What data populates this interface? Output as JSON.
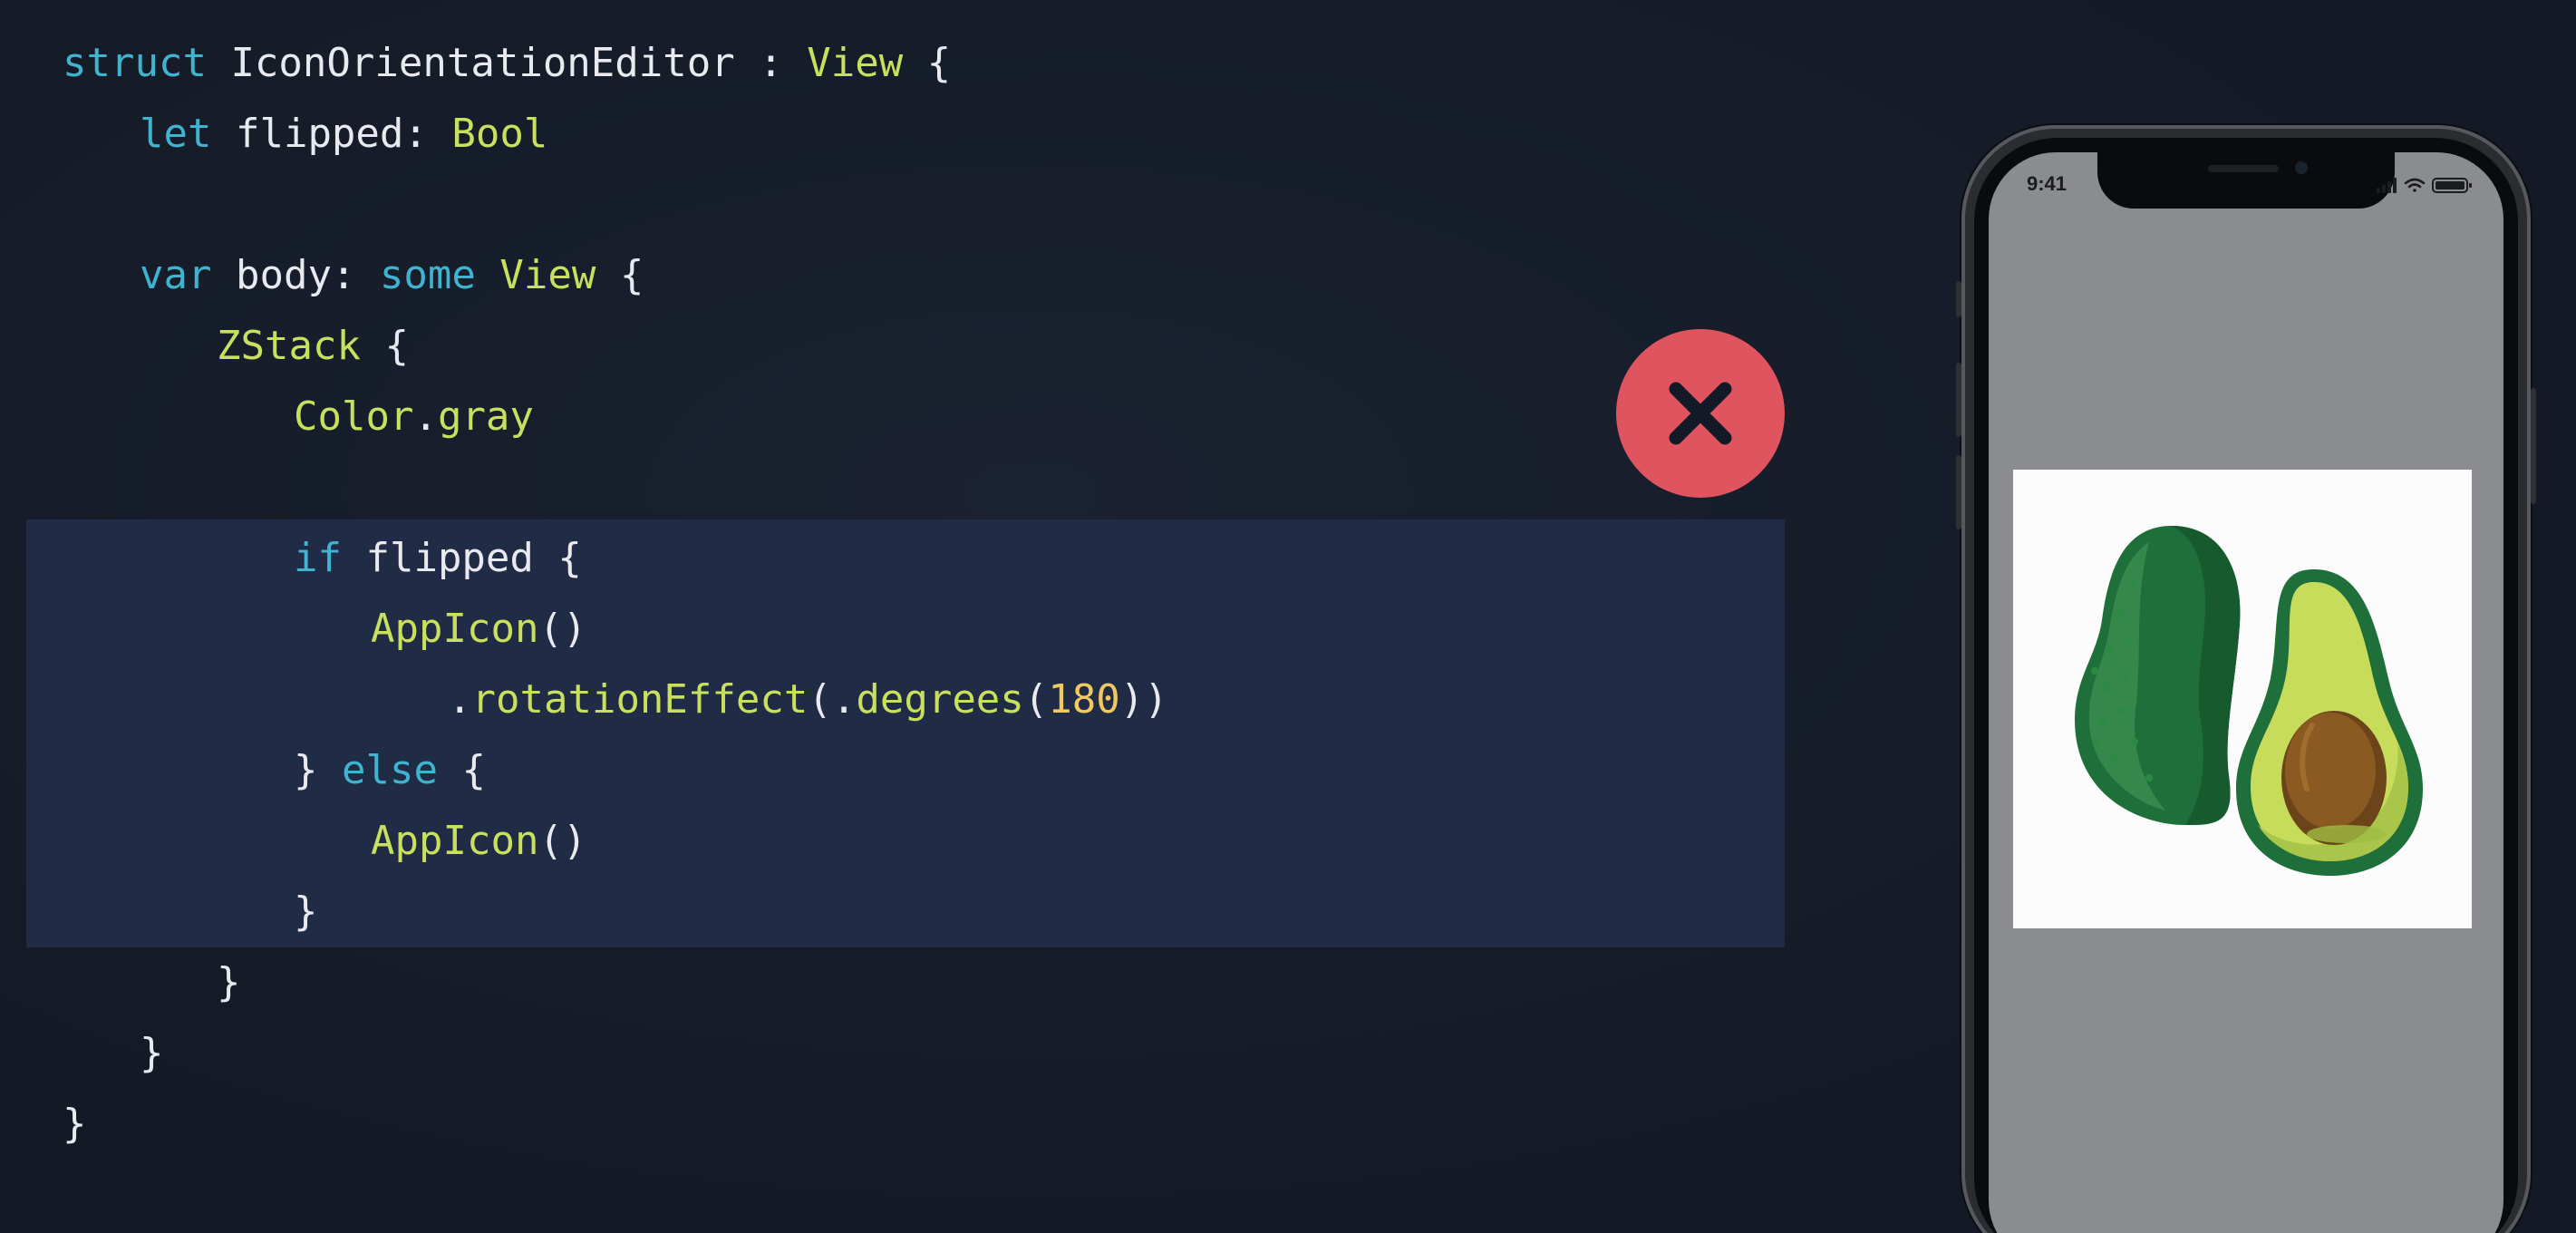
{
  "slide": {
    "background": "#141a25",
    "highlight_color": "#202b45"
  },
  "code": {
    "lines": [
      [
        {
          "t": "struct",
          "c": "kw"
        },
        {
          "t": " IconOrientationEditor : ",
          "c": "pl"
        },
        {
          "t": "View",
          "c": "ty"
        },
        {
          "t": " {",
          "c": "pl"
        }
      ],
      [
        {
          "t": "let",
          "c": "kw"
        },
        {
          "t": " flipped: ",
          "c": "pl"
        },
        {
          "t": "Bool",
          "c": "ty"
        }
      ],
      [],
      [
        {
          "t": "var",
          "c": "kw"
        },
        {
          "t": " body: ",
          "c": "pl"
        },
        {
          "t": "some",
          "c": "kw"
        },
        {
          "t": " ",
          "c": "pl"
        },
        {
          "t": "View",
          "c": "ty"
        },
        {
          "t": " {",
          "c": "pl"
        }
      ],
      [
        {
          "t": "ZStack",
          "c": "ty"
        },
        {
          "t": " {",
          "c": "pl"
        }
      ],
      [
        {
          "t": "Color",
          "c": "ty"
        },
        {
          "t": ".",
          "c": "pl"
        },
        {
          "t": "gray",
          "c": "ty"
        }
      ],
      [],
      [
        {
          "t": "if",
          "c": "kw"
        },
        {
          "t": " flipped {",
          "c": "pl"
        }
      ],
      [
        {
          "t": "AppIcon",
          "c": "ty"
        },
        {
          "t": "()",
          "c": "pl"
        }
      ],
      [
        {
          "t": ".",
          "c": "pl"
        },
        {
          "t": "rotationEffect",
          "c": "ty"
        },
        {
          "t": "(.",
          "c": "pl"
        },
        {
          "t": "degrees",
          "c": "ty"
        },
        {
          "t": "(",
          "c": "pl"
        },
        {
          "t": "180",
          "c": "nu"
        },
        {
          "t": "))",
          "c": "pl"
        }
      ],
      [
        {
          "t": "}",
          "c": "pl"
        },
        {
          "t": " ",
          "c": "pl"
        },
        {
          "t": "else",
          "c": "kw"
        },
        {
          "t": " {",
          "c": "pl"
        }
      ],
      [
        {
          "t": "AppIcon",
          "c": "ty"
        },
        {
          "t": "()",
          "c": "pl"
        }
      ],
      [
        {
          "t": "}",
          "c": "pl"
        }
      ],
      [
        {
          "t": "}",
          "c": "pl"
        }
      ],
      [
        {
          "t": "}",
          "c": "pl"
        }
      ],
      [
        {
          "t": "}",
          "c": "pl"
        }
      ]
    ],
    "indents": [
      0,
      1,
      0,
      1,
      2,
      3,
      0,
      3,
      4,
      5,
      3,
      4,
      3,
      2,
      1,
      0
    ],
    "highlighted_lines": [
      7,
      8,
      9,
      10,
      11,
      12
    ]
  },
  "result_badge": {
    "icon": "close-icon",
    "color": "#e0545f"
  },
  "phone": {
    "status_time": "9:41",
    "screen_color": "#8b8c8f",
    "app_icon": {
      "icon": "avocado-icon",
      "background": "#fbfcfb"
    }
  }
}
